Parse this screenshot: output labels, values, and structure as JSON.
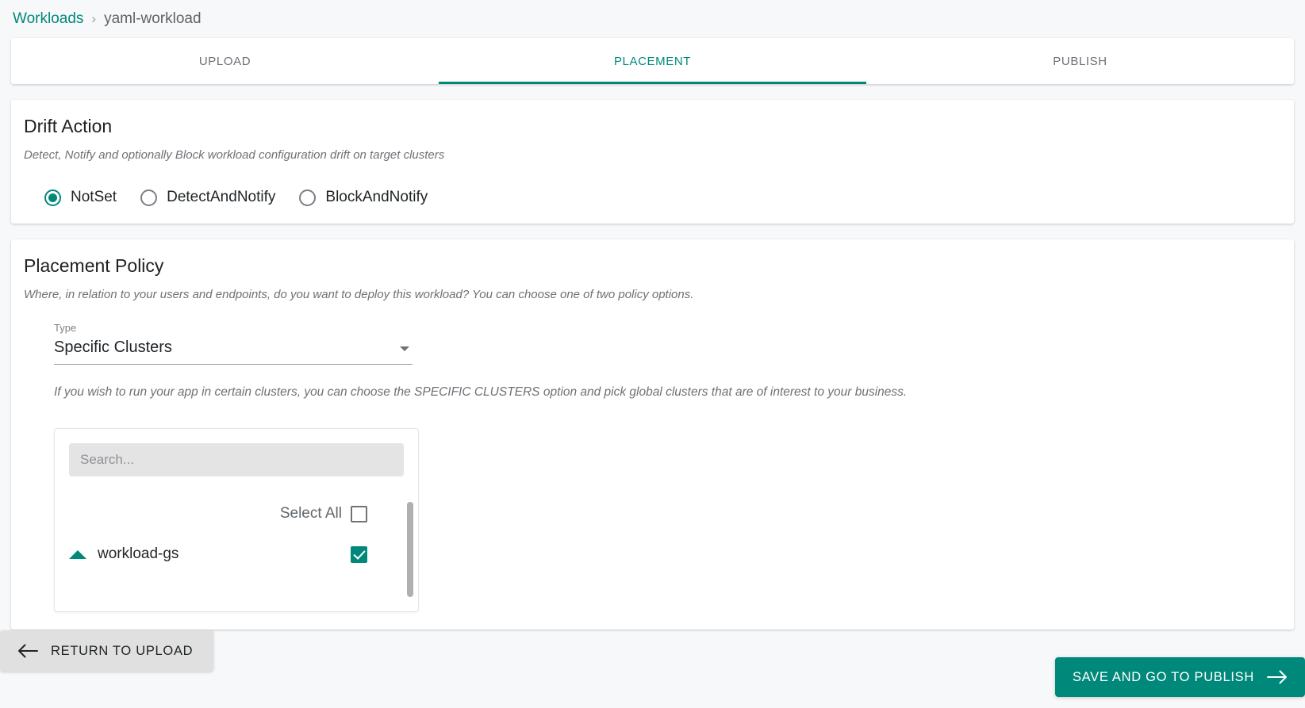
{
  "breadcrumb": {
    "root": "Workloads",
    "separator": "›",
    "current": "yaml-workload"
  },
  "tabs": [
    {
      "label": "UPLOAD",
      "active": false
    },
    {
      "label": "PLACEMENT",
      "active": true
    },
    {
      "label": "PUBLISH",
      "active": false
    }
  ],
  "drift_action": {
    "title": "Drift Action",
    "subtitle": "Detect, Notify and optionally Block workload configuration drift on target clusters",
    "options": [
      {
        "label": "NotSet",
        "checked": true
      },
      {
        "label": "DetectAndNotify",
        "checked": false
      },
      {
        "label": "BlockAndNotify",
        "checked": false
      }
    ]
  },
  "placement_policy": {
    "title": "Placement Policy",
    "subtitle": "Where, in relation to your users and endpoints, do you want to deploy this workload? You can choose one of two policy options.",
    "type_label": "Type",
    "type_value": "Specific Clusters",
    "hint": "If you wish to run your app in certain clusters, you can choose the SPECIFIC CLUSTERS option and pick global clusters that are of interest to your business.",
    "picker": {
      "search_placeholder": "Search...",
      "search_value": "",
      "select_all_label": "Select All",
      "select_all_checked": false,
      "clusters": [
        {
          "name": "workload-gs",
          "checked": true,
          "expanded": true
        }
      ]
    }
  },
  "footer": {
    "back_label": "RETURN TO UPLOAD",
    "next_label": "SAVE AND GO TO PUBLISH"
  },
  "colors": {
    "accent": "#00897b",
    "page_bg": "#f7f8f9",
    "card_bg": "#ffffff",
    "muted_text": "#6d7175",
    "back_button_bg": "#e0e0e0"
  }
}
